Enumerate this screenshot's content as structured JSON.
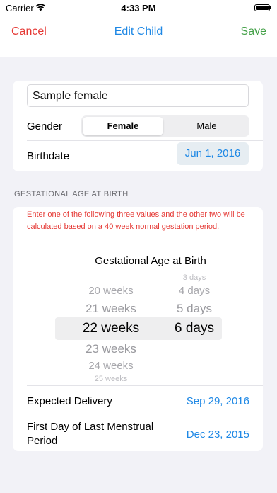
{
  "status_bar": {
    "carrier": "Carrier",
    "time": "4:33 PM",
    "wifi_icon": "wifi-icon",
    "battery_icon": "battery-icon"
  },
  "nav": {
    "cancel": "Cancel",
    "title": "Edit Child",
    "save": "Save"
  },
  "child": {
    "name": "Sample female",
    "gender_label": "Gender",
    "gender_options": [
      "Female",
      "Male"
    ],
    "gender_selected": "Female",
    "birthdate_label": "Birthdate",
    "birthdate_value": "Jun 1, 2016"
  },
  "gestation": {
    "section_title": "GESTATIONAL AGE AT BIRTH",
    "note": "Enter one of the following three values and the other two will be calculated based on a 40 week normal gestation period.",
    "picker_title": "Gestational Age at Birth",
    "weeks_items": [
      "20 weeks",
      "21 weeks",
      "22 weeks",
      "23 weeks",
      "24 weeks",
      "25 weeks"
    ],
    "days_items": [
      "3 days",
      "4 days",
      "5 days",
      "6 days"
    ],
    "selected_weeks": "22 weeks",
    "selected_days": "6 days",
    "expected_delivery_label": "Expected Delivery",
    "expected_delivery_value": "Sep 29, 2016",
    "lmp_label": "First Day of Last Menstrual Period",
    "lmp_value": "Dec 23, 2015"
  },
  "colors": {
    "cancel": "#e53935",
    "title": "#1e88e5",
    "save": "#43a047",
    "note": "#e53935",
    "link": "#1e88e5"
  }
}
